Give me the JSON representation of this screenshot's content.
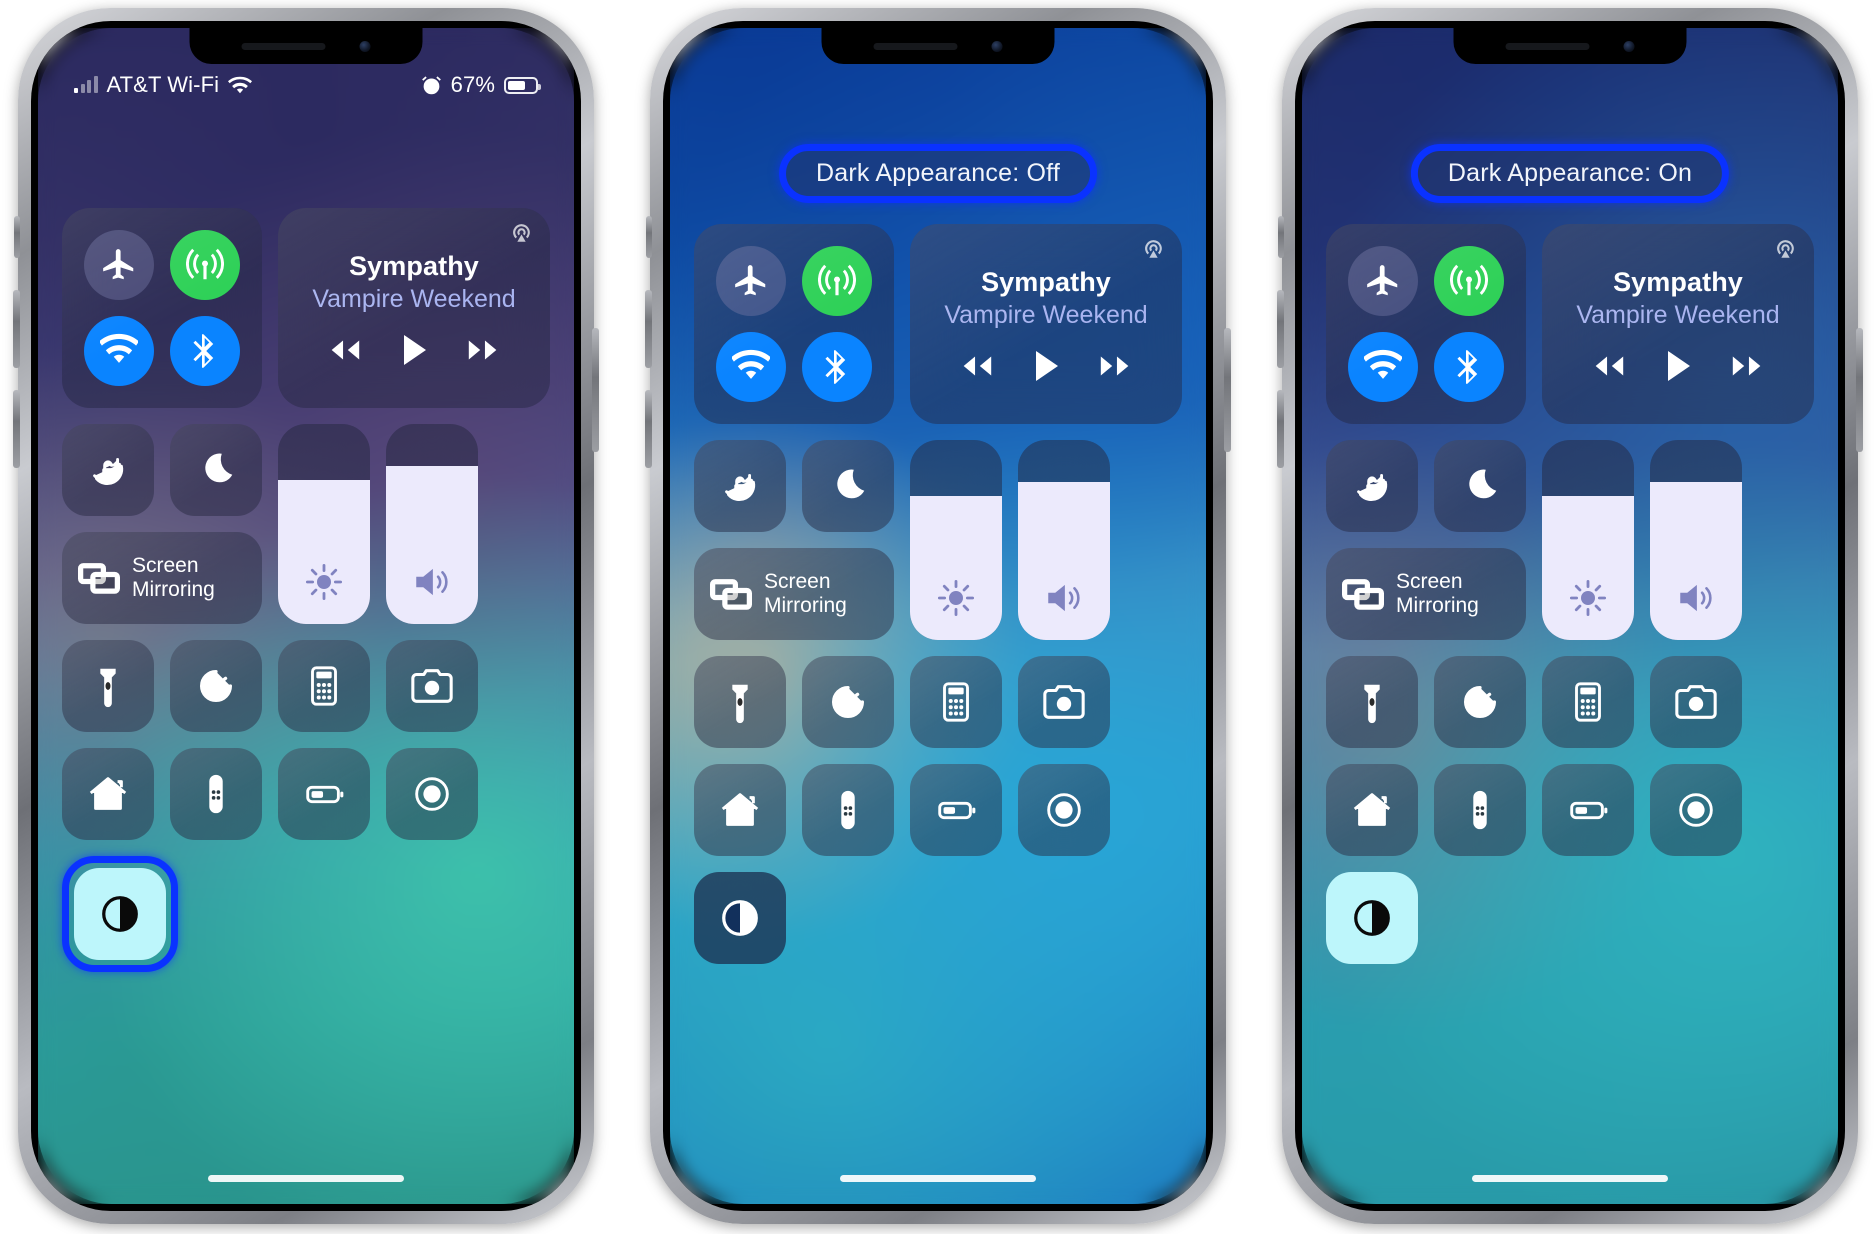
{
  "page": {
    "title": "iOS Control Center — Dark Appearance toggle"
  },
  "statusbar": {
    "carrier": "AT&T Wi-Fi",
    "battery_percent": "67%",
    "signal_icon": "cellular-signal-icon",
    "wifi_icon": "wifi-icon",
    "alarm_icon": "alarm-clock-icon",
    "battery_icon": "battery-icon"
  },
  "callouts": {
    "phone2": "Dark Appearance: Off",
    "phone3": "Dark Appearance: On",
    "highlight_color": "#0a32ff"
  },
  "connectivity": {
    "airplane": {
      "name": "airplane-mode-toggle",
      "state": "off"
    },
    "cellular": {
      "name": "cellular-data-toggle",
      "state": "on",
      "color": "#2fd158"
    },
    "wifi": {
      "name": "wifi-toggle",
      "state": "on",
      "color": "#0a84ff"
    },
    "bluetooth": {
      "name": "bluetooth-toggle",
      "state": "on",
      "color": "#0a84ff"
    }
  },
  "now_playing": {
    "track": "Sympathy",
    "artist": "Vampire Weekend",
    "airplay_icon": "airplay-audio-icon",
    "rewind_icon": "rewind-icon",
    "play_icon": "play-icon",
    "fastforward_icon": "fast-forward-icon"
  },
  "tiles": {
    "rotation_lock": "Rotation Lock",
    "do_not_disturb": "Do Not Disturb",
    "screen_mirroring": "Screen\nMirroring",
    "screen_mirroring_line1": "Screen",
    "screen_mirroring_line2": "Mirroring",
    "flashlight": "Flashlight",
    "timer": "Timer",
    "calculator": "Calculator",
    "camera": "Camera",
    "home": "Home",
    "apple_tv_remote": "Apple TV Remote",
    "low_power_mode": "Low Power Mode",
    "screen_recording": "Screen Recording",
    "dark_mode": "Dark Appearance"
  },
  "sliders": {
    "brightness": {
      "name": "brightness-slider",
      "level": 72
    },
    "volume": {
      "name": "volume-slider",
      "level": 79
    }
  },
  "dark_mode_states": {
    "phone1": "on",
    "phone2": "off",
    "phone3": "on"
  }
}
